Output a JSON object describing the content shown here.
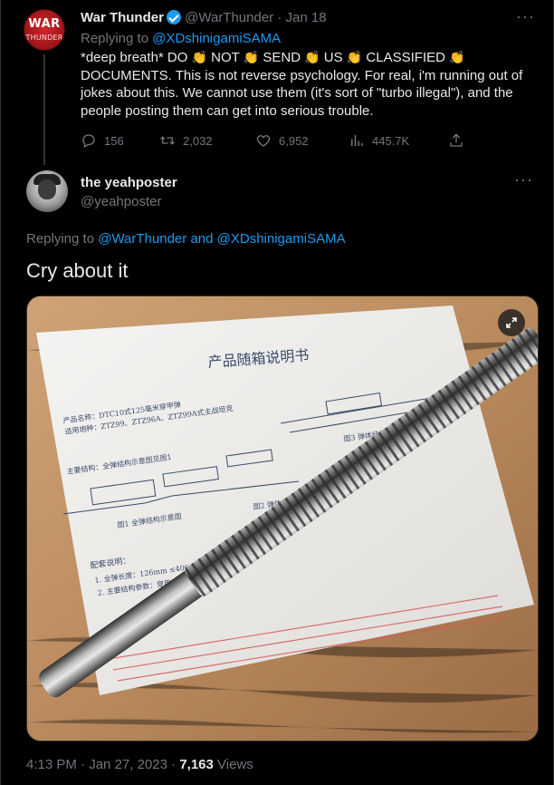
{
  "parent_tweet": {
    "author_name": "War Thunder",
    "handle": "@WarThunder",
    "date": "Jan 18",
    "avatar_text_top": "WAR",
    "avatar_text_bottom": "THUNDER",
    "reply_prefix": "Replying to",
    "reply_mention": "@XDshinigamiSAMA",
    "text_segments": {
      "s1": "*deep breath* DO ",
      "s2": " NOT ",
      "s3": " SEND ",
      "s4": " US ",
      "s5": " CLASSIFIED ",
      "s6": " DOCUMENTS. This is not reverse psychology. For real, i'm running out of jokes about this. We cannot use them (it's sort of \"turbo illegal\"), and the people posting them can get into serious trouble."
    },
    "clap_emoji": "👏",
    "stats": {
      "replies": "156",
      "retweets": "2,032",
      "likes": "6,952",
      "views": "445.7K"
    }
  },
  "main_tweet": {
    "author_name": "the yeahposter",
    "handle": "@yeahposter",
    "reply_prefix": "Replying to",
    "reply_mention_1": "@WarThunder",
    "reply_and": "and",
    "reply_mention_2": "@XDshinigamiSAMA",
    "text": "Cry about it",
    "image": {
      "doc_title": "产品随箱说明书",
      "doc_caption_1": "图1 全弹结构示意图",
      "doc_caption_2": "图2 弹体结构示意图",
      "doc_caption_3": "图3 弹体结构及零部件",
      "doc_section": "配套说明：",
      "doc_line_1": "产品名称：DTC10式125毫米穿甲弹",
      "doc_line_2": "适用炮种：ZTZ99、ZTZ96A、ZTZ99A式主战坦克",
      "doc_line_3": "主要结构：全弹结构示意图见图1",
      "doc_line_4": "1. 全弹长度：126mm  ≤406mm",
      "doc_line_5": "2. 主要结构参数：穿甲、初速"
    },
    "time": "4:13 PM",
    "separator": "·",
    "date": "Jan 27, 2023",
    "views_count": "7,163",
    "views_label": "Views"
  },
  "icons": {
    "reply": "reply-icon",
    "retweet": "retweet-icon",
    "like": "heart-icon",
    "views": "analytics-icon",
    "share": "share-icon",
    "more": "more-icon",
    "expand": "expand-icon",
    "verified": "verified-badge-icon"
  },
  "colors": {
    "background": "#000000",
    "text": "#e7e9ea",
    "muted": "#71767b",
    "accent": "#1d9bf0",
    "verified": "#1d9bf0",
    "wt_avatar": "#c4161c"
  }
}
